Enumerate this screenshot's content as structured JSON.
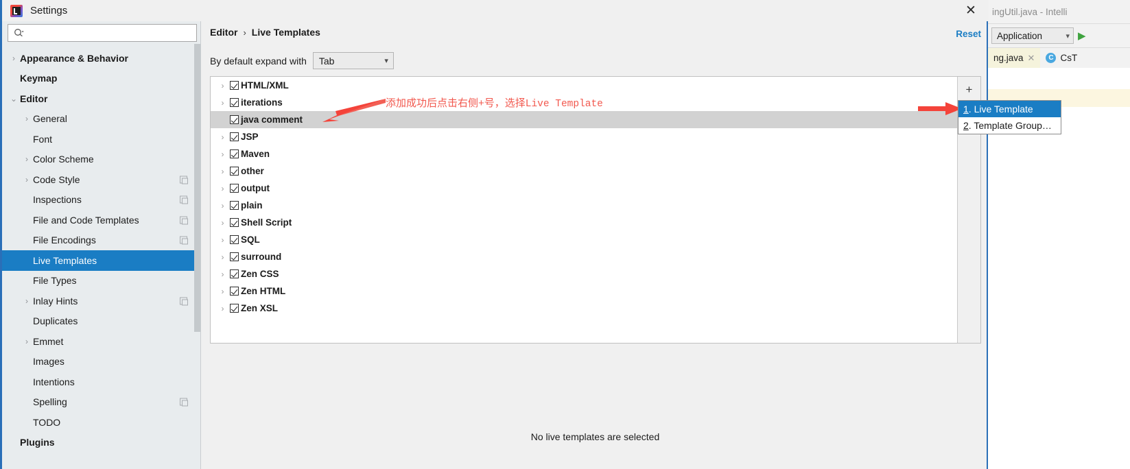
{
  "window": {
    "title": "Settings",
    "close_label": "✕",
    "logo_icon": "intellij-logo-icon"
  },
  "search": {
    "value": "",
    "placeholder": "",
    "icon": "search-icon"
  },
  "sidebar": {
    "items": [
      {
        "label": "Appearance & Behavior",
        "level": 0,
        "arrow": "right",
        "bold": true,
        "badge": false,
        "selected": false
      },
      {
        "label": "Keymap",
        "level": 0,
        "arrow": "none",
        "bold": true,
        "badge": false,
        "selected": false
      },
      {
        "label": "Editor",
        "level": 0,
        "arrow": "down",
        "bold": true,
        "badge": false,
        "selected": false
      },
      {
        "label": "General",
        "level": 1,
        "arrow": "right",
        "bold": false,
        "badge": false,
        "selected": false
      },
      {
        "label": "Font",
        "level": 1,
        "arrow": "none",
        "bold": false,
        "badge": false,
        "selected": false
      },
      {
        "label": "Color Scheme",
        "level": 1,
        "arrow": "right",
        "bold": false,
        "badge": false,
        "selected": false
      },
      {
        "label": "Code Style",
        "level": 1,
        "arrow": "right",
        "bold": false,
        "badge": true,
        "selected": false
      },
      {
        "label": "Inspections",
        "level": 1,
        "arrow": "none",
        "bold": false,
        "badge": true,
        "selected": false
      },
      {
        "label": "File and Code Templates",
        "level": 1,
        "arrow": "none",
        "bold": false,
        "badge": true,
        "selected": false
      },
      {
        "label": "File Encodings",
        "level": 1,
        "arrow": "none",
        "bold": false,
        "badge": true,
        "selected": false
      },
      {
        "label": "Live Templates",
        "level": 1,
        "arrow": "none",
        "bold": false,
        "badge": false,
        "selected": true
      },
      {
        "label": "File Types",
        "level": 1,
        "arrow": "none",
        "bold": false,
        "badge": false,
        "selected": false
      },
      {
        "label": "Inlay Hints",
        "level": 1,
        "arrow": "right",
        "bold": false,
        "badge": true,
        "selected": false
      },
      {
        "label": "Duplicates",
        "level": 1,
        "arrow": "none",
        "bold": false,
        "badge": false,
        "selected": false
      },
      {
        "label": "Emmet",
        "level": 1,
        "arrow": "right",
        "bold": false,
        "badge": false,
        "selected": false
      },
      {
        "label": "Images",
        "level": 1,
        "arrow": "none",
        "bold": false,
        "badge": false,
        "selected": false
      },
      {
        "label": "Intentions",
        "level": 1,
        "arrow": "none",
        "bold": false,
        "badge": false,
        "selected": false
      },
      {
        "label": "Spelling",
        "level": 1,
        "arrow": "none",
        "bold": false,
        "badge": true,
        "selected": false
      },
      {
        "label": "TODO",
        "level": 1,
        "arrow": "none",
        "bold": false,
        "badge": false,
        "selected": false
      },
      {
        "label": "Plugins",
        "level": 0,
        "arrow": "none",
        "bold": true,
        "badge": false,
        "selected": false
      }
    ]
  },
  "main": {
    "breadcrumb": {
      "root": "Editor",
      "separator": "›",
      "leaf": "Live Templates"
    },
    "reset_label": "Reset",
    "expand_row": {
      "label": "By default expand with",
      "selected_value": "Tab",
      "chevron_icon": "chevron-down-icon"
    },
    "tree_rows": [
      {
        "label": "HTML/XML",
        "expandable": true,
        "checked": true,
        "selected": false
      },
      {
        "label": "iterations",
        "expandable": true,
        "checked": true,
        "selected": false
      },
      {
        "label": "java comment",
        "expandable": false,
        "checked": true,
        "selected": true
      },
      {
        "label": "JSP",
        "expandable": true,
        "checked": true,
        "selected": false
      },
      {
        "label": "Maven",
        "expandable": true,
        "checked": true,
        "selected": false
      },
      {
        "label": "other",
        "expandable": true,
        "checked": true,
        "selected": false
      },
      {
        "label": "output",
        "expandable": true,
        "checked": true,
        "selected": false
      },
      {
        "label": "plain",
        "expandable": true,
        "checked": true,
        "selected": false
      },
      {
        "label": "Shell Script",
        "expandable": true,
        "checked": true,
        "selected": false
      },
      {
        "label": "SQL",
        "expandable": true,
        "checked": true,
        "selected": false
      },
      {
        "label": "surround",
        "expandable": true,
        "checked": true,
        "selected": false
      },
      {
        "label": "Zen CSS",
        "expandable": true,
        "checked": true,
        "selected": false
      },
      {
        "label": "Zen HTML",
        "expandable": true,
        "checked": true,
        "selected": false
      },
      {
        "label": "Zen XSL",
        "expandable": true,
        "checked": true,
        "selected": false
      }
    ],
    "toolbar": {
      "add_label": "+",
      "remove_label": "▬",
      "revert_label": "↶"
    },
    "empty_message": "No live templates are selected"
  },
  "popup_menu": {
    "items": [
      {
        "number": "1",
        "label": ". Live Template",
        "active": true
      },
      {
        "number": "2",
        "label": ". Template Group…",
        "active": false
      }
    ]
  },
  "annotation": {
    "text_part1": "添加成功后点击右侧+号，选择",
    "text_part2": "Live Template",
    "color": "#f2584e"
  },
  "ide_background": {
    "title": "ingUtil.java - Intelli",
    "run_config": "Application",
    "run_icon": "run-play-icon",
    "tab_label": "ng.java",
    "tab_close": "✕",
    "class_badge": "C",
    "class_label": "CsT"
  },
  "colors": {
    "selection_blue": "#1a7dc4",
    "accent_link": "#1a7dc4",
    "annotation_red": "#f2584e",
    "dialog_bg": "#f0f0f0",
    "sidebar_bg": "#e8ecee"
  }
}
